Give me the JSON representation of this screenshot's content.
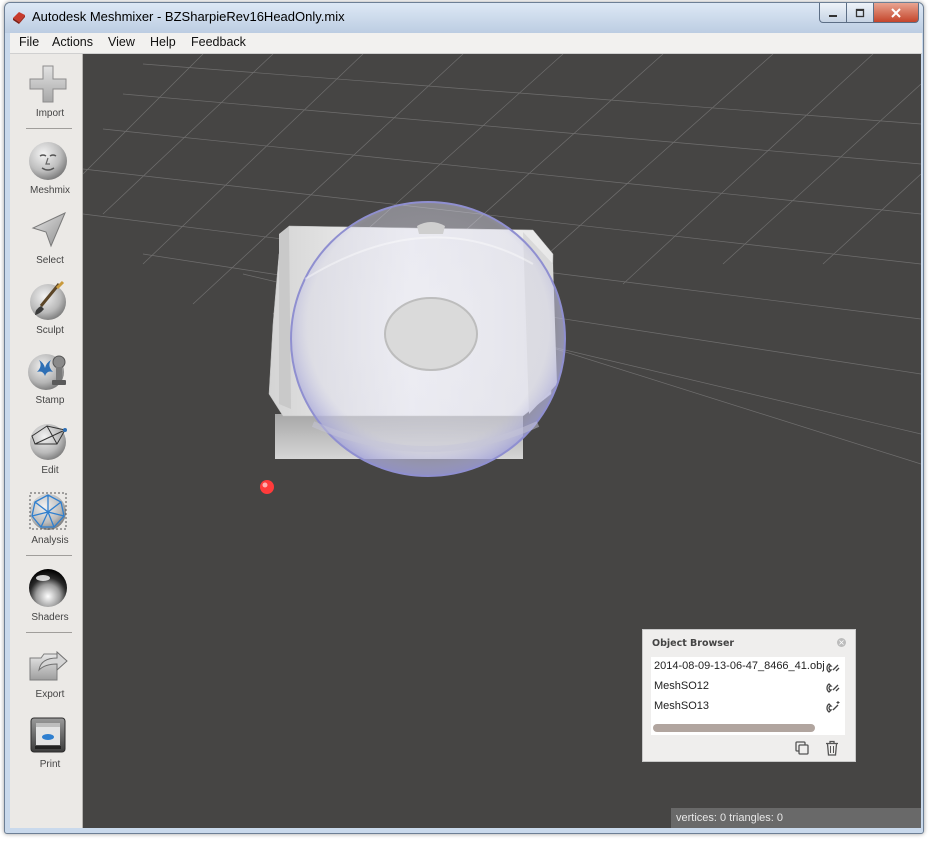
{
  "window": {
    "title": "Autodesk Meshmixer - BZSharpieRev16HeadOnly.mix"
  },
  "menu": [
    "File",
    "Actions",
    "View",
    "Help",
    "Feedback"
  ],
  "toolbar": {
    "tools": [
      {
        "label": "Import",
        "icon": "plus-icon"
      },
      {
        "label": "Meshmix",
        "icon": "face-icon"
      },
      {
        "label": "Select",
        "icon": "arrow-cursor-icon"
      },
      {
        "label": "Sculpt",
        "icon": "brush-icon"
      },
      {
        "label": "Stamp",
        "icon": "stamp-icon"
      },
      {
        "label": "Edit",
        "icon": "edit-mesh-icon"
      },
      {
        "label": "Analysis",
        "icon": "analysis-icon"
      },
      {
        "label": "Shaders",
        "icon": "shader-sphere-icon"
      },
      {
        "label": "Export",
        "icon": "export-icon"
      },
      {
        "label": "Print",
        "icon": "printer-icon"
      }
    ]
  },
  "object_browser": {
    "title": "Object Browser",
    "items": [
      {
        "label": "2014-08-09-13-06-47_8466_41.obj"
      },
      {
        "label": "MeshSO12"
      },
      {
        "label": "MeshSO13"
      }
    ]
  },
  "status": {
    "text": "vertices: 0 triangles: 0"
  },
  "colors": {
    "viewport_bg": "#464544",
    "toolbar_bg": "#ebe9e6",
    "brush_sphere": "#a9a9e6",
    "point_marker": "#ff3b3b"
  }
}
